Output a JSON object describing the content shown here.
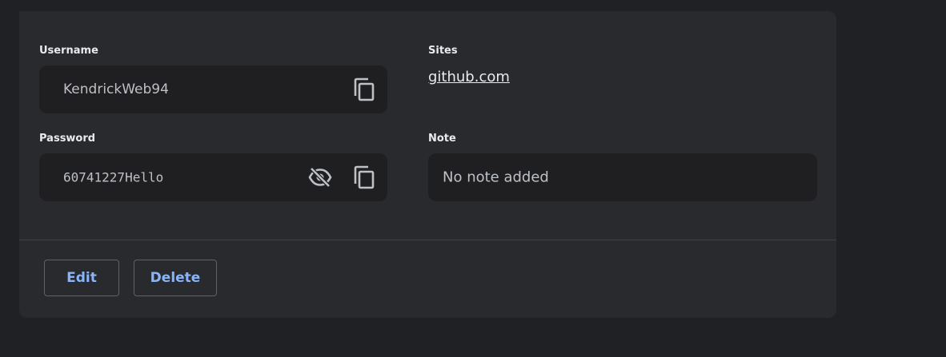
{
  "username": {
    "label": "Username",
    "value": "KendrickWeb94",
    "copy_icon": "copy-icon"
  },
  "password": {
    "label": "Password",
    "value": "60741227Hello",
    "visibility_icon": "eye-off-icon",
    "copy_icon": "copy-icon"
  },
  "sites": {
    "label": "Sites",
    "items": [
      "github.com"
    ]
  },
  "note": {
    "label": "Note",
    "value": "No note added"
  },
  "actions": {
    "edit_label": "Edit",
    "delete_label": "Delete"
  },
  "colors": {
    "page_bg": "#202124",
    "card_bg": "#292a2d",
    "field_bg": "#1f1f21",
    "accent": "#8ab4f8"
  }
}
